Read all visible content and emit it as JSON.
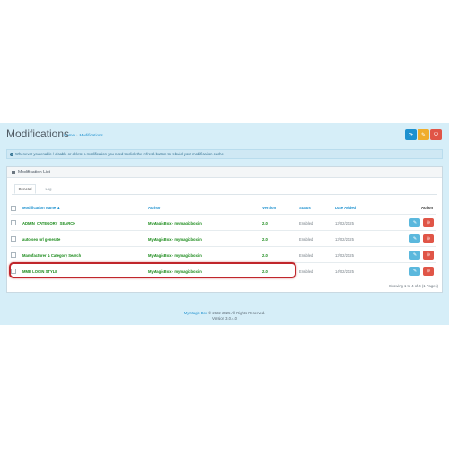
{
  "page": {
    "title": "Modifications",
    "breadcrumb": [
      "Home",
      "Modifications"
    ]
  },
  "toolbar": {
    "refresh_icon": "refresh-icon",
    "clear_icon": "eraser-icon",
    "delete_icon": "power-off-icon",
    "colors": {
      "refresh": "#1e91cf",
      "clear": "#f0ad2c",
      "off": "#e05547"
    }
  },
  "alert": {
    "text": "Whenever you enable / disable or delete a modification you need to click the refresh button to rebuild your modification cache!"
  },
  "panel": {
    "title": "Modification List",
    "tabs": [
      "General",
      "Log"
    ]
  },
  "table": {
    "columns": [
      "Modification Name",
      "Author",
      "Version",
      "Status",
      "Date Added",
      "Action"
    ],
    "rows": [
      {
        "name": "ADMIN_CATEGORY_SEARCH",
        "author": "MyMagicBox - mymagicbox.in",
        "version": "2.0",
        "status": "Enabled",
        "date": "13/02/2025"
      },
      {
        "name": "auto seo url generate",
        "author": "MyMagicBox - mymagicbox.in",
        "version": "2.0",
        "status": "Enabled",
        "date": "13/02/2025"
      },
      {
        "name": "Manufacturer & Category Search",
        "author": "MyMagicBox - mymagicbox.in",
        "version": "2.0",
        "status": "Enabled",
        "date": "13/02/2025"
      },
      {
        "name": "MMB LOGIN STYLE",
        "author": "MyMagicBox - mymagicbox.in",
        "version": "2.0",
        "status": "Enabled",
        "date": "14/02/2025"
      }
    ],
    "showing": "Showing 1 to 4 of 4 (1 Pages)"
  },
  "footer": {
    "brand": "My Magic Box",
    "copyright": "© 2022-2025 All Rights Reserved.",
    "version": "Version 3.0.4.0"
  }
}
